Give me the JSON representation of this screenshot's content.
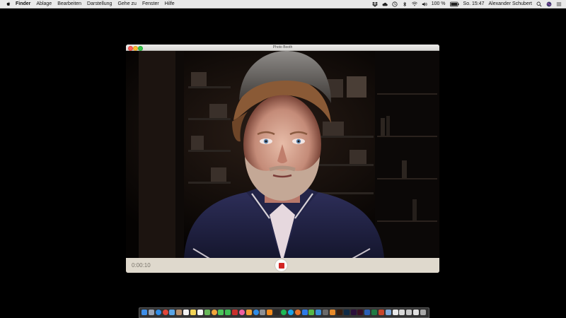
{
  "menubar": {
    "items": [
      "Finder",
      "Ablage",
      "Bearbeiten",
      "Darstellung",
      "Gehe zu",
      "Fenster",
      "Hilfe"
    ],
    "status": {
      "battery": "100 %",
      "clock": "So. 15:47",
      "user": "Alexander Schubert"
    }
  },
  "window": {
    "title": "Photo Booth",
    "recording_time": "0:00:10"
  },
  "dock": {
    "items": [
      {
        "icon": "finder-icon",
        "color": "#3e8ee8"
      },
      {
        "icon": "launchpad-icon",
        "color": "#9aa3b3"
      },
      {
        "icon": "safari-icon",
        "color": "#2f8de8"
      },
      {
        "icon": "chrome-icon",
        "color": "#e2463a"
      },
      {
        "icon": "mail-icon",
        "color": "#5aa5e6"
      },
      {
        "icon": "contacts-icon",
        "color": "#b9906b"
      },
      {
        "icon": "calendar-icon",
        "color": "#f2f2f2"
      },
      {
        "icon": "notes-icon",
        "color": "#f3d557"
      },
      {
        "icon": "reminders-icon",
        "color": "#f4f4f4"
      },
      {
        "icon": "maps-icon",
        "color": "#68b85a"
      },
      {
        "icon": "photos-icon",
        "color": "#f2a63c"
      },
      {
        "icon": "messages-icon",
        "color": "#4bc55a"
      },
      {
        "icon": "facetime-icon",
        "color": "#3fbf55"
      },
      {
        "icon": "photo-booth-icon",
        "color": "#c9302c"
      },
      {
        "icon": "itunes-icon",
        "color": "#ee5fa0"
      },
      {
        "icon": "ibooks-icon",
        "color": "#f0a030"
      },
      {
        "icon": "app-store-icon",
        "color": "#2e8ce6"
      },
      {
        "icon": "system-preferences-icon",
        "color": "#8d8f94"
      },
      {
        "icon": "vlc-icon",
        "color": "#f38b1c"
      },
      {
        "icon": "terminal-icon",
        "color": "#2a2a2a"
      },
      {
        "icon": "spotify-icon",
        "color": "#1db954"
      },
      {
        "icon": "skype-icon",
        "color": "#1aa3e8"
      },
      {
        "icon": "firefox-icon",
        "color": "#e8742a"
      },
      {
        "icon": "dropbox-icon",
        "color": "#2d7ae8"
      },
      {
        "icon": "evernote-icon",
        "color": "#57b847"
      },
      {
        "icon": "xcode-icon",
        "color": "#3b8fd8"
      },
      {
        "icon": "logic-icon",
        "color": "#6a6a6a"
      },
      {
        "icon": "garageband-icon",
        "color": "#e68a2a"
      },
      {
        "icon": "illustrator-icon",
        "color": "#3a1e0e"
      },
      {
        "icon": "photoshop-icon",
        "color": "#0e2a46"
      },
      {
        "icon": "premiere-icon",
        "color": "#2a0e3a"
      },
      {
        "icon": "indesign-icon",
        "color": "#3a0e22"
      },
      {
        "icon": "word-icon",
        "color": "#2b5fb4"
      },
      {
        "icon": "excel-icon",
        "color": "#1f7a43"
      },
      {
        "icon": "powerpoint-icon",
        "color": "#c8462a"
      },
      {
        "icon": "preview-icon",
        "color": "#7fa8d8"
      },
      {
        "icon": "document-icon",
        "color": "#e8e8e8"
      },
      {
        "icon": "document-icon",
        "color": "#d8d8d8"
      },
      {
        "icon": "downloads-stack-icon",
        "color": "#c8c8c8"
      },
      {
        "icon": "document-icon",
        "color": "#e0e0e0"
      },
      {
        "icon": "trash-icon",
        "color": "#a8a8a8"
      }
    ]
  },
  "colors": {
    "record_red": "#d22523",
    "window_bg": "#dbd5c9"
  }
}
